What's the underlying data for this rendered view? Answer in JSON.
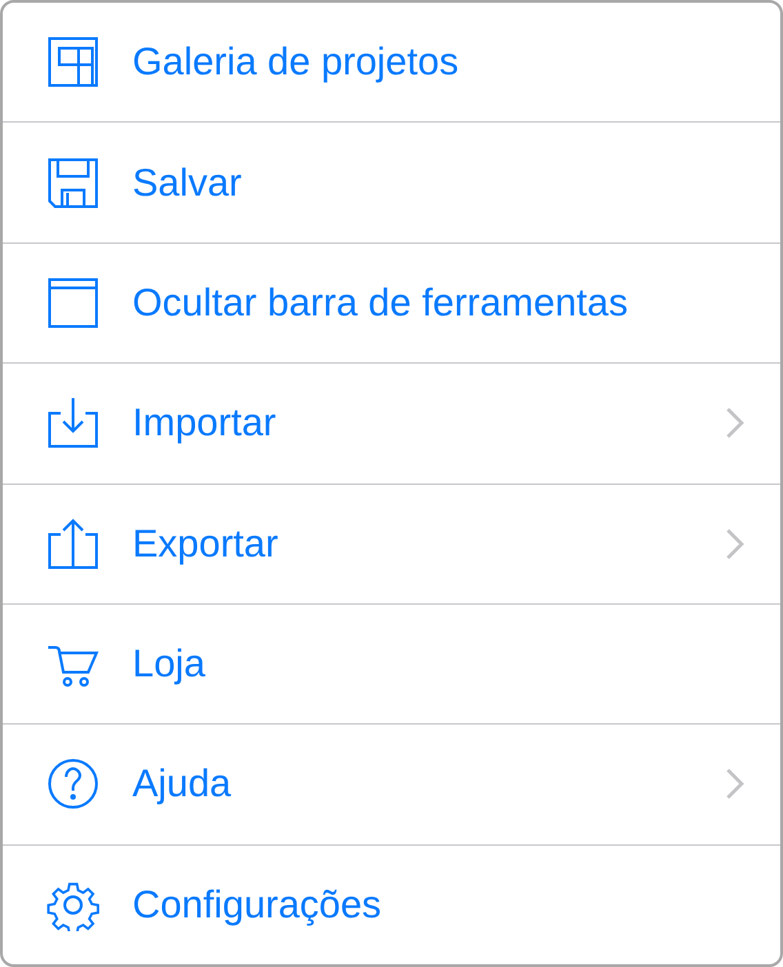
{
  "menu": {
    "items": [
      {
        "label": "Galeria de projetos",
        "has_submenu": false
      },
      {
        "label": "Salvar",
        "has_submenu": false
      },
      {
        "label": "Ocultar barra de ferramentas",
        "has_submenu": false
      },
      {
        "label": "Importar",
        "has_submenu": true
      },
      {
        "label": "Exportar",
        "has_submenu": true
      },
      {
        "label": "Loja",
        "has_submenu": false
      },
      {
        "label": "Ajuda",
        "has_submenu": true
      },
      {
        "label": "Configurações",
        "has_submenu": false
      }
    ]
  }
}
